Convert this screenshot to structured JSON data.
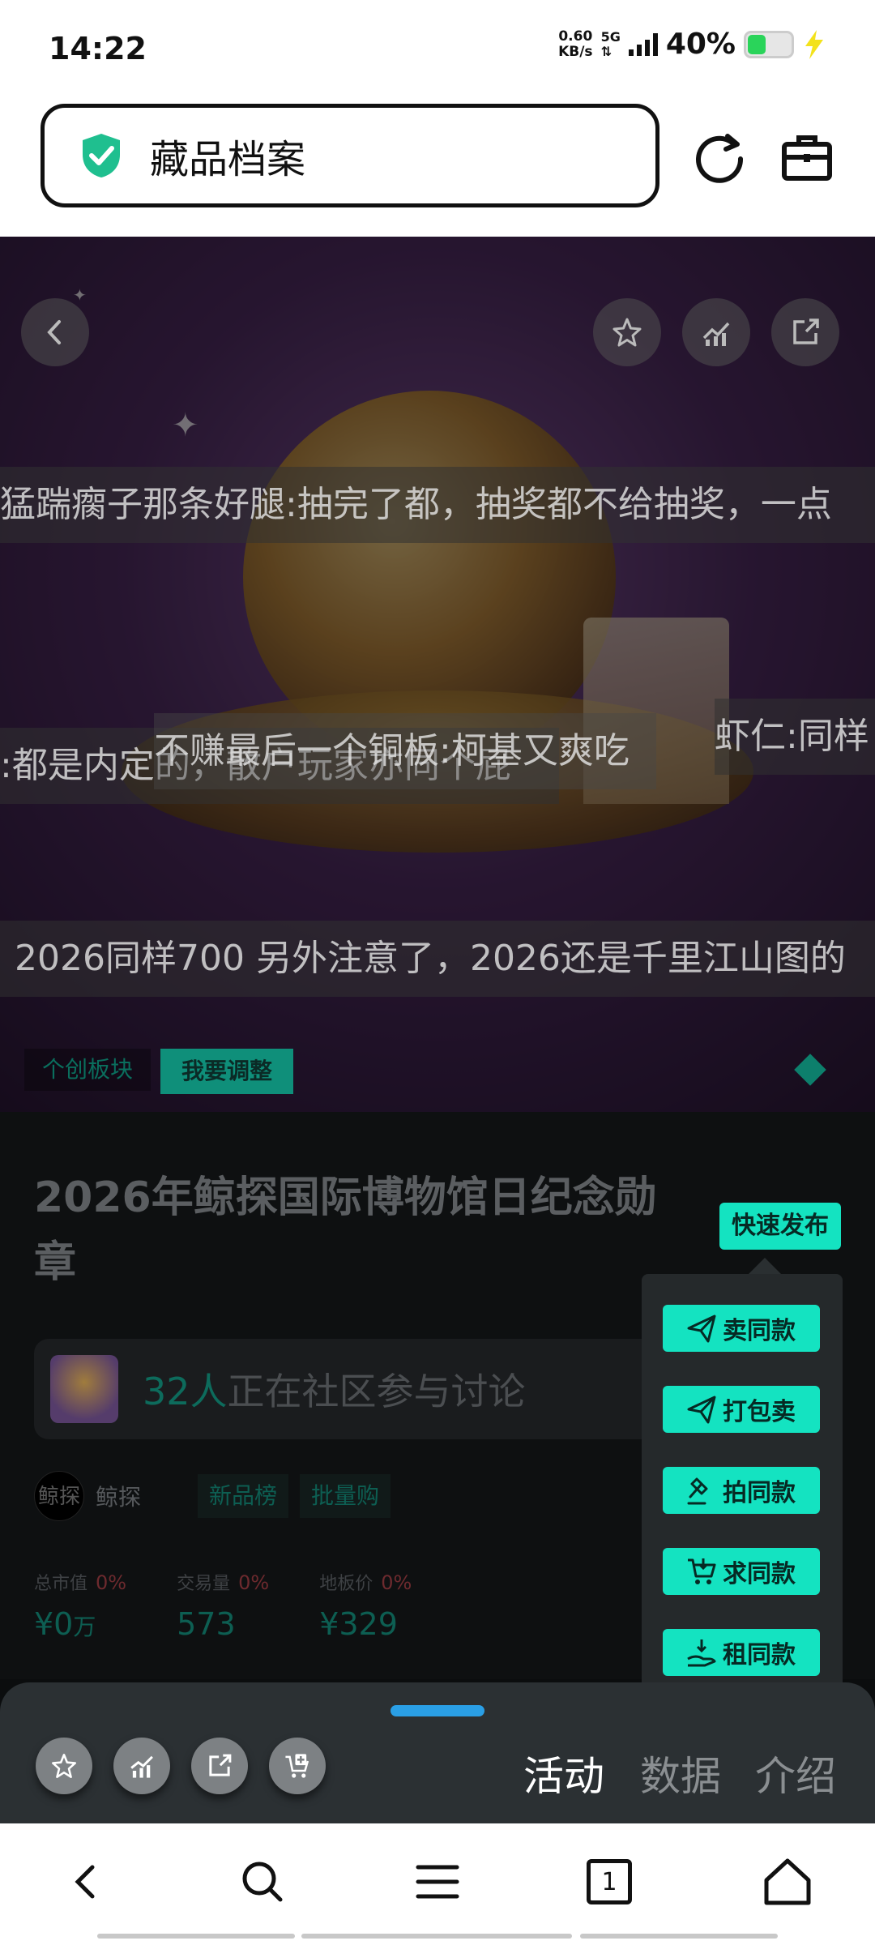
{
  "status_bar": {
    "time": "14:22",
    "net_speed_value": "0.60",
    "net_speed_unit": "KB/s",
    "network_type": "5G",
    "battery_percent": "40%",
    "battery_level": 0.4,
    "battery_color": "#2ad45a"
  },
  "address_bar": {
    "page_title": "藏品档案",
    "shield_icon": "shield-check-icon",
    "reload_icon": "reload-icon",
    "toolbox_icon": "toolbox-icon"
  },
  "hero": {
    "danmu": [
      "猛踹瘸子那条好腿:抽完了都，抽奖都不给抽奖，一点",
      ":都是内定的，散户玩家亦同个屁",
      "不赚最后一个铜板:柯基又爽吃",
      "虾仁:同样",
      "2026同样700 另外注意了，2026还是千里江山图的"
    ],
    "tag_board": "个创板块",
    "tag_adjust": "我要调整"
  },
  "item": {
    "title": "2026年鲸探国际博物馆日纪念勋章",
    "discussion_count": "32人",
    "discussion_text": "正在社区参与讨论",
    "brand_logo_text": "鲸探",
    "brand_name": "鲸探",
    "chips": [
      "新品榜",
      "批量购"
    ],
    "stats": [
      {
        "label": "总市值",
        "change": "0%",
        "value": "¥0",
        "unit": "万"
      },
      {
        "label": "交易量",
        "change": "0%",
        "value": "573",
        "unit": ""
      },
      {
        "label": "地板价",
        "change": "0%",
        "value": "¥329",
        "unit": ""
      }
    ]
  },
  "quick_publish": {
    "button_label": "快速发布",
    "items": [
      {
        "label": "卖同款",
        "icon": "send-icon"
      },
      {
        "label": "打包卖",
        "icon": "send-icon"
      },
      {
        "label": "拍同款",
        "icon": "gavel-icon"
      },
      {
        "label": "求同款",
        "icon": "cart-icon"
      },
      {
        "label": "租同款",
        "icon": "hand-give-icon"
      }
    ],
    "accent": "#14e3c1"
  },
  "bottom_sheet": {
    "tabs": [
      "活动",
      "数据",
      "介绍"
    ],
    "active_tab": "活动",
    "handle_color": "#2a9fe6"
  },
  "nav_bar": {
    "tab_count": "1"
  }
}
